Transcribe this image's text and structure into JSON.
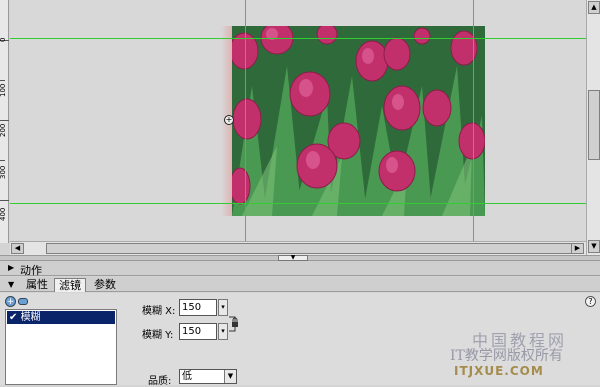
{
  "ruler": {
    "labels": [
      "0",
      "100",
      "200",
      "300",
      "400"
    ]
  },
  "panels": {
    "actions_title": "动作",
    "tabs": [
      {
        "label": "属性"
      },
      {
        "label": "滤镜"
      },
      {
        "label": "参数"
      }
    ],
    "active_tab": "滤镜"
  },
  "filters": {
    "list": [
      {
        "label": "模糊"
      }
    ],
    "blur_x_label": "模糊 X:",
    "blur_x_value": "150",
    "blur_y_label": "模糊 Y:",
    "blur_y_value": "150",
    "quality_label": "品质:",
    "quality_value": "低"
  },
  "help_label": "?",
  "watermark": {
    "line1": "中国教程网",
    "line2": "IT教学网版权所有",
    "line3": "ITJXUE.COM"
  },
  "colors": {
    "guide": "#33cc33",
    "selection": "#0a246a",
    "tulip": "#c2306c",
    "leaf": "#3f8f4a"
  },
  "icons": [
    "plus-icon",
    "minus-icon",
    "lock-icon",
    "registration-point-icon",
    "help-icon",
    "collapse-triangle-icon"
  ]
}
